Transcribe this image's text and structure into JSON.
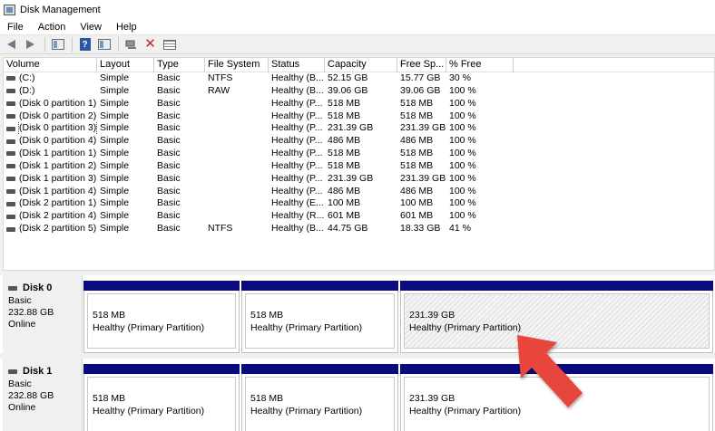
{
  "window": {
    "title": "Disk Management"
  },
  "menu": [
    "File",
    "Action",
    "View",
    "Help"
  ],
  "toolbar": {
    "icons": [
      "back-arrow-icon",
      "forward-arrow-icon",
      "console-tree-icon",
      "help-icon",
      "properties-icon",
      "connect-icon",
      "delete-icon",
      "list-view-icon"
    ]
  },
  "table": {
    "columns": [
      "Volume",
      "Layout",
      "Type",
      "File System",
      "Status",
      "Capacity",
      "Free Sp...",
      "% Free"
    ],
    "rows": [
      [
        "(C:)",
        "Simple",
        "Basic",
        "NTFS",
        "Healthy (B...",
        "52.15 GB",
        "15.77 GB",
        "30 %"
      ],
      [
        "(D:)",
        "Simple",
        "Basic",
        "RAW",
        "Healthy (B...",
        "39.06 GB",
        "39.06 GB",
        "100 %"
      ],
      [
        "(Disk 0 partition 1)",
        "Simple",
        "Basic",
        "",
        "Healthy (P...",
        "518 MB",
        "518 MB",
        "100 %"
      ],
      [
        "(Disk 0 partition 2)",
        "Simple",
        "Basic",
        "",
        "Healthy (P...",
        "518 MB",
        "518 MB",
        "100 %"
      ],
      [
        "(Disk 0 partition 3)",
        "Simple",
        "Basic",
        "",
        "Healthy (P...",
        "231.39 GB",
        "231.39 GB",
        "100 %"
      ],
      [
        "(Disk 0 partition 4)",
        "Simple",
        "Basic",
        "",
        "Healthy (P...",
        "486 MB",
        "486 MB",
        "100 %"
      ],
      [
        "(Disk 1 partition 1)",
        "Simple",
        "Basic",
        "",
        "Healthy (P...",
        "518 MB",
        "518 MB",
        "100 %"
      ],
      [
        "(Disk 1 partition 2)",
        "Simple",
        "Basic",
        "",
        "Healthy (P...",
        "518 MB",
        "518 MB",
        "100 %"
      ],
      [
        "(Disk 1 partition 3)",
        "Simple",
        "Basic",
        "",
        "Healthy (P...",
        "231.39 GB",
        "231.39 GB",
        "100 %"
      ],
      [
        "(Disk 1 partition 4)",
        "Simple",
        "Basic",
        "",
        "Healthy (P...",
        "486 MB",
        "486 MB",
        "100 %"
      ],
      [
        "(Disk 2 partition 1)",
        "Simple",
        "Basic",
        "",
        "Healthy (E...",
        "100 MB",
        "100 MB",
        "100 %"
      ],
      [
        "(Disk 2 partition 4)",
        "Simple",
        "Basic",
        "",
        "Healthy (R...",
        "601 MB",
        "601 MB",
        "100 %"
      ],
      [
        "(Disk 2 partition 5)",
        "Simple",
        "Basic",
        "NTFS",
        "Healthy (B...",
        "44.75 GB",
        "18.33 GB",
        "41 %"
      ]
    ],
    "selected_row": 4
  },
  "disks": [
    {
      "name": "Disk 0",
      "type": "Basic",
      "size": "232.88 GB",
      "status": "Online",
      "partitions": [
        {
          "size": "518 MB",
          "status": "Healthy (Primary Partition)"
        },
        {
          "size": "518 MB",
          "status": "Healthy (Primary Partition)"
        },
        {
          "size": "231.39 GB",
          "status": "Healthy (Primary Partition)",
          "selected": true
        }
      ]
    },
    {
      "name": "Disk 1",
      "type": "Basic",
      "size": "232.88 GB",
      "status": "Online",
      "partitions": [
        {
          "size": "518 MB",
          "status": "Healthy (Primary Partition)"
        },
        {
          "size": "518 MB",
          "status": "Healthy (Primary Partition)"
        },
        {
          "size": "231.39 GB",
          "status": "Healthy (Primary Partition)"
        }
      ]
    }
  ],
  "colors": {
    "partition_bar": "#0b0b80",
    "pointer_arrow": "#e8453c",
    "delete_icon": "#d12222"
  }
}
